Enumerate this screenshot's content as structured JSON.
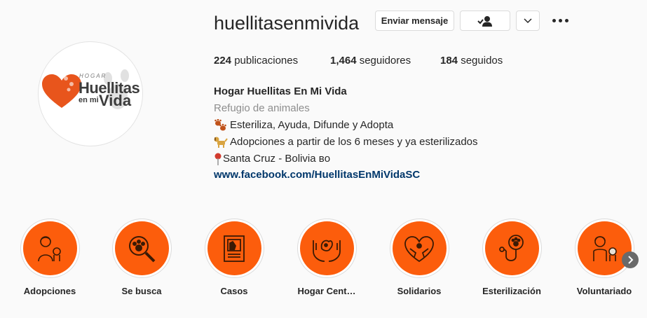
{
  "profile": {
    "username": "huellitasenmivida",
    "message_button": "Enviar mensaje",
    "follow_icon": "person-check-icon",
    "dropdown_icon": "chevron-down-icon",
    "more_icon": "more-dots-icon",
    "logo": {
      "hogar": "HOGAR",
      "line1": "Huellitas",
      "line2a": "en mi",
      "line2b": "Vida"
    }
  },
  "stats": [
    {
      "value": "224",
      "label": "publicaciones"
    },
    {
      "value": "1,464",
      "label": "seguidores"
    },
    {
      "value": "184",
      "label": "seguidos"
    }
  ],
  "bio": {
    "name": "Hogar Huellitas En Mi Vida",
    "category": "Refugio de animales",
    "lines": [
      {
        "icon": "paw-prints-icon",
        "text": "Esteriliza, Ayuda, Difunde y Adopta"
      },
      {
        "icon": "dog-icon",
        "text": "Adopciones a partir de los 6 meses y ya esterilizados"
      },
      {
        "icon": "map-pin-icon",
        "text": "Santa Cruz - Bolivia ʙᴏ"
      }
    ],
    "link": "www.facebook.com/HuellitasEnMiVidaSC"
  },
  "highlights": [
    {
      "label": "Adopciones",
      "icon": "girl-with-dog-icon"
    },
    {
      "label": "Se busca",
      "icon": "magnifier-paw-icon"
    },
    {
      "label": "Casos",
      "icon": "document-icon"
    },
    {
      "label": "Hogar Cent…",
      "icon": "hands-pet-icon"
    },
    {
      "label": "Solidarios",
      "icon": "heart-hands-icon"
    },
    {
      "label": "Esterilización",
      "icon": "stethoscope-paw-icon"
    },
    {
      "label": "Voluntariado",
      "icon": "volunteer-with-dog-icon"
    }
  ],
  "colors": {
    "highlight_orange": "#fc5d0c",
    "link_blue": "#00376b"
  }
}
